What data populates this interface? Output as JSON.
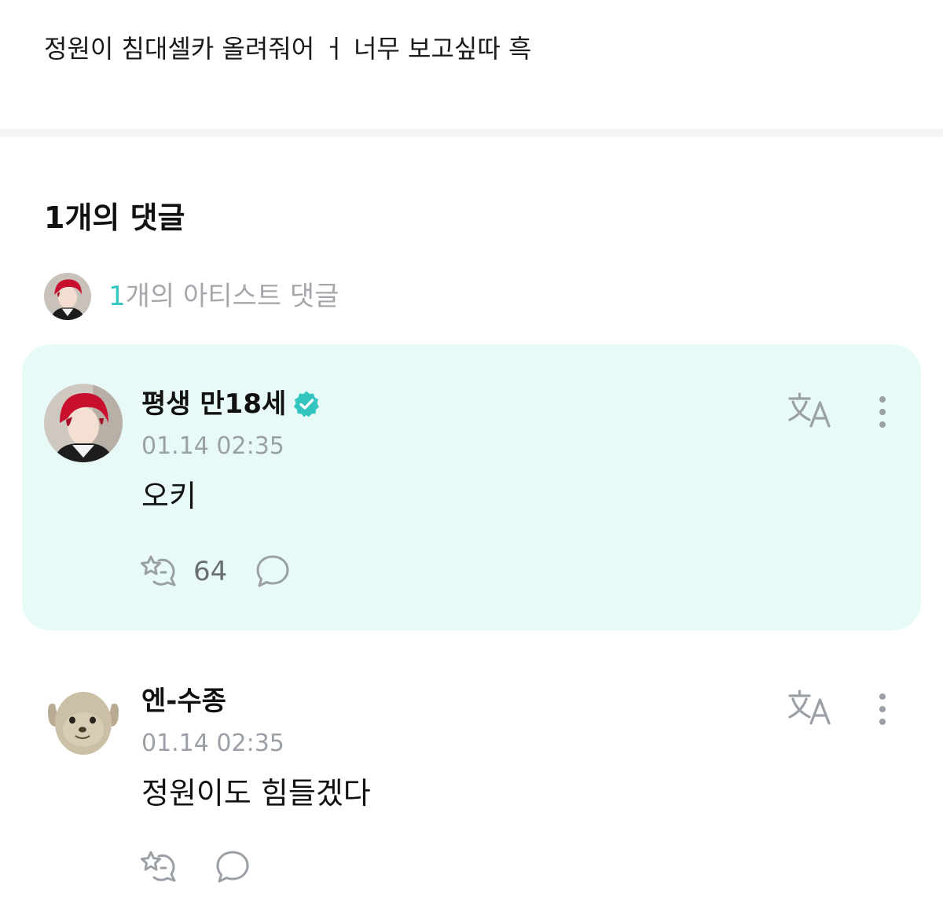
{
  "post": {
    "text": "정원이 침대셀카 올려줘어 ㅓ 너무 보고싶따 흑"
  },
  "comments_section": {
    "title": "1개의 댓글",
    "artist_summary": {
      "count": "1",
      "label": "개의 아티스트 댓글"
    }
  },
  "comments": [
    {
      "author": "평생 만18세",
      "verified": true,
      "timestamp": "01.14 02:35",
      "text": "오키",
      "likes": "64",
      "highlighted": true
    },
    {
      "author": "엔-수종",
      "verified": false,
      "timestamp": "01.14 02:35",
      "text": "정원이도 힘들겠다",
      "highlighted": false
    }
  ],
  "icons": {
    "verified": "verified-badge-icon",
    "translate": "translate-icon",
    "more": "more-vertical-icon",
    "like": "like-icon",
    "reply": "reply-icon"
  },
  "colors": {
    "accent": "#35c5c0",
    "highlight_background": "#e8faf7",
    "muted_text": "#9aa0a6",
    "icon_gray": "#9aa0a6"
  }
}
